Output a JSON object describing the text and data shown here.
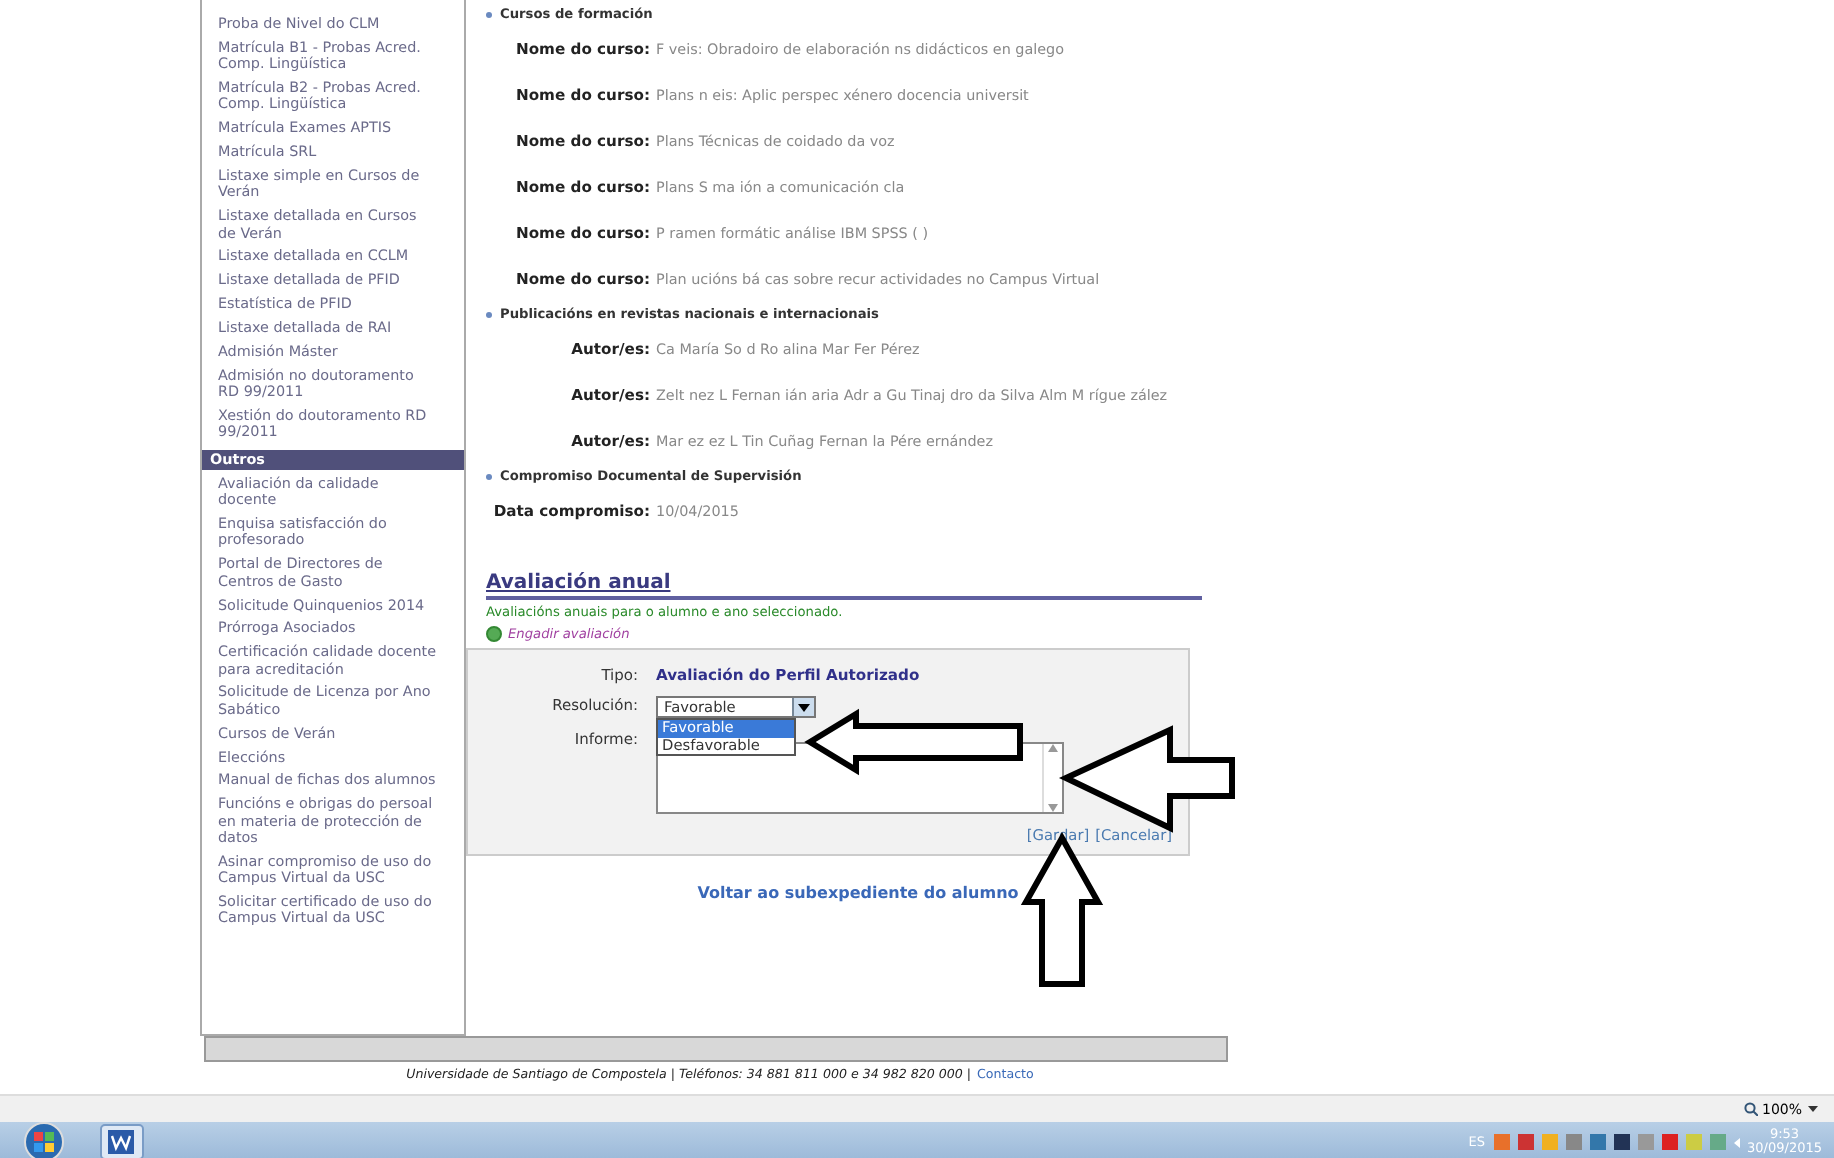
{
  "sidebar": {
    "sections": [
      {
        "items": [
          "Proba de Nivel do CLM",
          "Matrícula B1 - Probas Acred. Comp. Lingüística",
          "Matrícula B2 - Probas Acred. Comp. Lingüística",
          "Matrícula Exames APTIS",
          "Matrícula SRL",
          "Listaxe simple en Cursos de Verán",
          "Listaxe detallada en Cursos de Verán",
          "Listaxe detallada en CCLM",
          "Listaxe detallada de PFID",
          "Estatística de PFID",
          "Listaxe detallada de RAI",
          "Admisión Máster",
          "Admisión no doutoramento RD 99/2011",
          "Xestión do doutoramento RD 99/2011"
        ]
      },
      {
        "title": "Outros",
        "items": [
          "Avaliación da calidade docente",
          "Enquisa satisfacción do profesorado",
          "Portal de Directores de Centros de Gasto",
          "Solicitude Quinquenios 2014",
          "Prórroga Asociados",
          "Certificación calidade docente para acreditación",
          "Solicitude de Licenza por Ano Sabático",
          "Cursos de Verán",
          "Eleccións",
          "Manual de fichas dos alumnos",
          "Funcións e obrigas do persoal en materia de protección de datos",
          "Asinar compromiso de uso do Campus Virtual da USC",
          "Solicitar certificado de uso do Campus Virtual da USC"
        ]
      }
    ]
  },
  "sections": [
    {
      "title": "Cursos de formación",
      "rows": [
        {
          "label": "Nome do curso:",
          "value": "F veis: Obradoiro de elaboración ns didácticos en galego"
        },
        {
          "label": "Nome do curso:",
          "value": "Plans n eis: Aplic perspec xénero docencia universit"
        },
        {
          "label": "Nome do curso:",
          "value": "Plans Técnicas de coidado da voz"
        },
        {
          "label": "Nome do curso:",
          "value": "Plans S ma ión a comunicación cla"
        },
        {
          "label": "Nome do curso:",
          "value": "P ramen formátic análise IBM SPSS ( )"
        },
        {
          "label": "Nome do curso:",
          "value": "Plan ucións bá cas sobre recur actividades no Campus Virtual"
        }
      ]
    },
    {
      "title": "Publicacións en revistas nacionais e internacionais",
      "rows": [
        {
          "label": "Autor/es:",
          "value": "Ca María So d Ro alina Mar Fer Pérez"
        },
        {
          "label": "Autor/es:",
          "value": "Zelt nez L Fernan ián aria Adr a Gu Tinaj dro da Silva Alm M rígue zález"
        },
        {
          "label": "Autor/es:",
          "value": "Mar ez ez L Tin Cuñag Fernan la Pére ernández"
        }
      ]
    },
    {
      "title": "Compromiso Documental de Supervisión",
      "rows": [
        {
          "label": "Data compromiso:",
          "value": "10/04/2015"
        }
      ]
    }
  ],
  "annual": {
    "title": "Avaliación anual",
    "subtitle": "Avaliacións anuais para o alumno e ano seleccionado.",
    "add_link": "Engadir avaliación",
    "form": {
      "type_label": "Tipo:",
      "type_value": "Avaliación do Perfil Autorizado",
      "resolution_label": "Resolución:",
      "resolution_value": "Favorable",
      "options": [
        {
          "label": "Favorable",
          "selected": true
        },
        {
          "label": "Desfavorable",
          "selected": false
        }
      ],
      "report_label": "Informe:",
      "save": "[Gardar]",
      "cancel": "[Cancelar]"
    },
    "back_link": "Voltar ao subexpediente do alumno"
  },
  "footer": {
    "text": "Universidade de Santiago de Compostela | Teléfonos: 34 881 811 000 e 34 982 820 000 |",
    "contact": "Contacto"
  },
  "status_bar": {
    "zoom": "100%"
  },
  "taskbar": {
    "language": "ES",
    "time": "9:53",
    "date": "30/09/2015"
  }
}
